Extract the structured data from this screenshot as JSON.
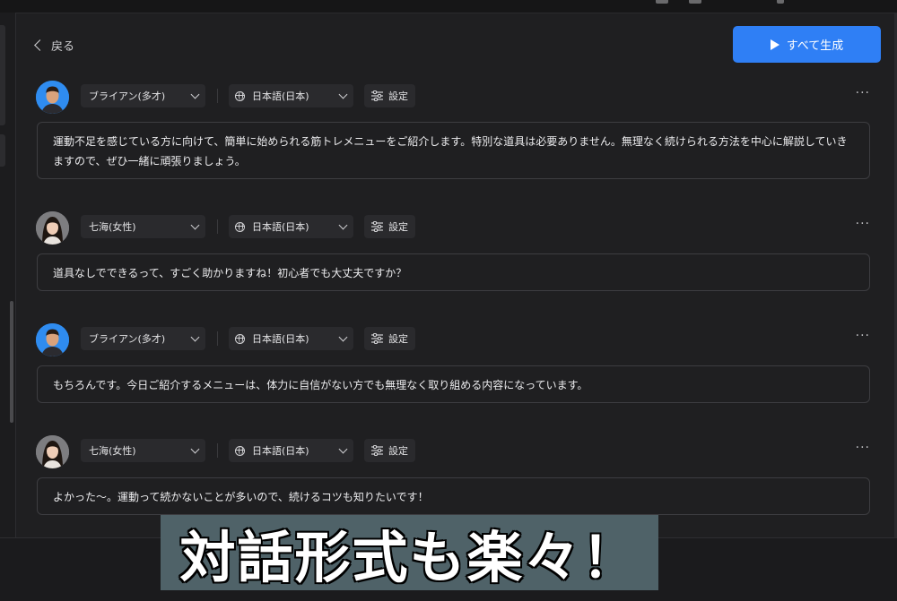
{
  "header": {
    "back_label": "戻る",
    "generate_all_label": "すべて生成"
  },
  "colors": {
    "accent": "#2f7ff5",
    "background": "#1f1f21",
    "control_bg": "#2a2a2d",
    "caption_bg": "#4f6268"
  },
  "dialogue": [
    {
      "speaker": "ブライアン(多才)",
      "avatar": "male-avatar",
      "language": "日本語(日本)",
      "settings_label": "設定",
      "more_label": "···",
      "text": "運動不足を感じている方に向けて、簡単に始められる筋トレメニューをご紹介します。特別な道具は必要ありません。無理なく続けられる方法を中心に解説していきますので、ぜひ一緒に頑張りましょう。"
    },
    {
      "speaker": "七海(女性)",
      "avatar": "female-avatar",
      "language": "日本語(日本)",
      "settings_label": "設定",
      "more_label": "···",
      "text": "道具なしでできるって、すごく助かりますね！初心者でも大丈夫ですか？"
    },
    {
      "speaker": "ブライアン(多才)",
      "avatar": "male-avatar",
      "language": "日本語(日本)",
      "settings_label": "設定",
      "more_label": "···",
      "text": "もちろんです。今日ご紹介するメニューは、体力に自信がない方でも無理なく取り組める内容になっています。"
    },
    {
      "speaker": "七海(女性)",
      "avatar": "female-avatar",
      "language": "日本語(日本)",
      "settings_label": "設定",
      "more_label": "···",
      "text": "よかった〜。運動って続かないことが多いので、続けるコツも知りたいです！"
    }
  ],
  "caption": {
    "text": "対話形式も楽々！"
  }
}
